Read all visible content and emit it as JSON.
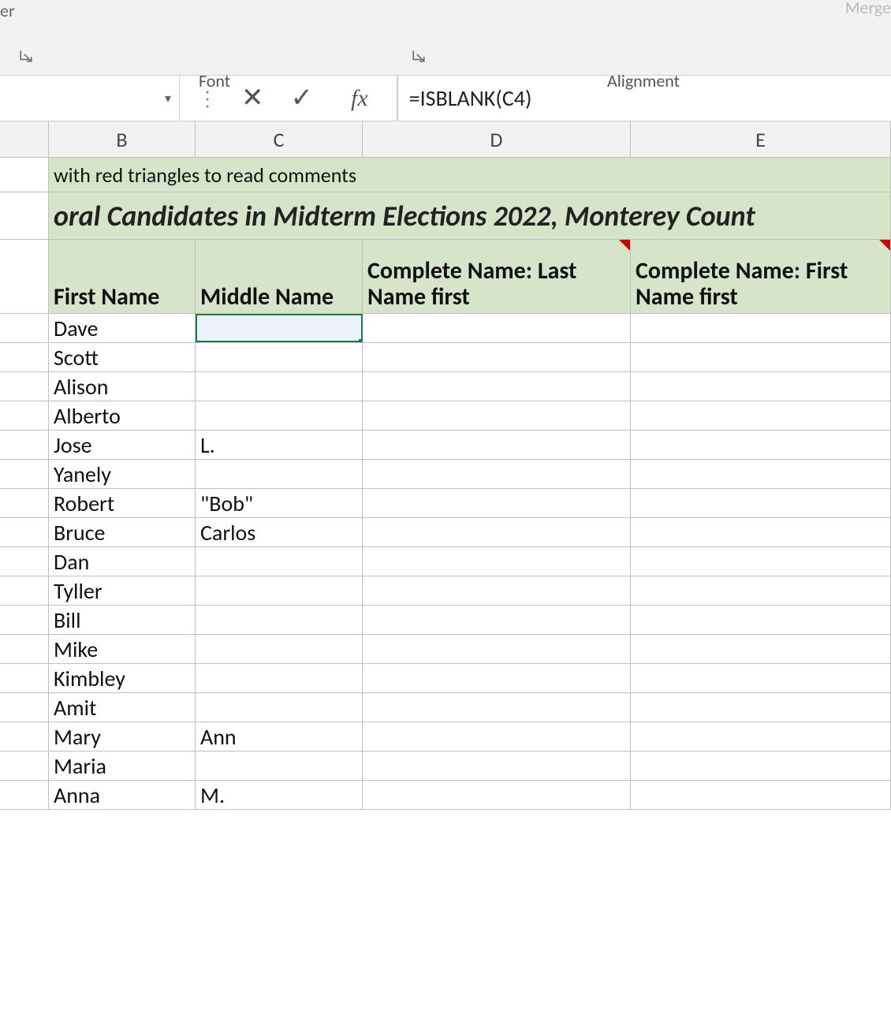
{
  "ribbon": {
    "fragment_left": "er",
    "group_font": "Font",
    "group_alignment": "Alignment",
    "merge_cut": "Merge"
  },
  "formula_bar": {
    "name_box": "",
    "fx_label": "fx",
    "formula": "=ISBLANK(C4)"
  },
  "columns": {
    "A": "",
    "B": "B",
    "C": "C",
    "D": "D",
    "E": "E"
  },
  "sheet": {
    "hint_row": "with red triangles to read comments",
    "title_row": "oral Candidates in Midterm Elections 2022, Monterey Count",
    "headers": {
      "B": "First Name",
      "C": "Middle Name",
      "D": "Complete Name: Last Name first",
      "E": "Complete Name: First Name first"
    },
    "rows": [
      {
        "first": "Dave",
        "middle": ""
      },
      {
        "first": "Scott",
        "middle": ""
      },
      {
        "first": "Alison",
        "middle": ""
      },
      {
        "first": "Alberto",
        "middle": ""
      },
      {
        "first": "Jose",
        "middle": "L."
      },
      {
        "first": "Yanely",
        "middle": ""
      },
      {
        "first": "Robert",
        "middle": "\"Bob\""
      },
      {
        "first": "Bruce",
        "middle": "Carlos"
      },
      {
        "first": "Dan",
        "middle": ""
      },
      {
        "first": "Tyller",
        "middle": ""
      },
      {
        "first": "Bill",
        "middle": ""
      },
      {
        "first": "Mike",
        "middle": ""
      },
      {
        "first": "Kimbley",
        "middle": ""
      },
      {
        "first": "Amit",
        "middle": ""
      },
      {
        "first": "Mary",
        "middle": "Ann"
      },
      {
        "first": "Maria",
        "middle": ""
      },
      {
        "first": "Anna",
        "middle": "M."
      }
    ]
  },
  "colors": {
    "header_green": "#d6e5c9",
    "active_outline": "#1a7f37",
    "comment_red": "#d00000"
  }
}
